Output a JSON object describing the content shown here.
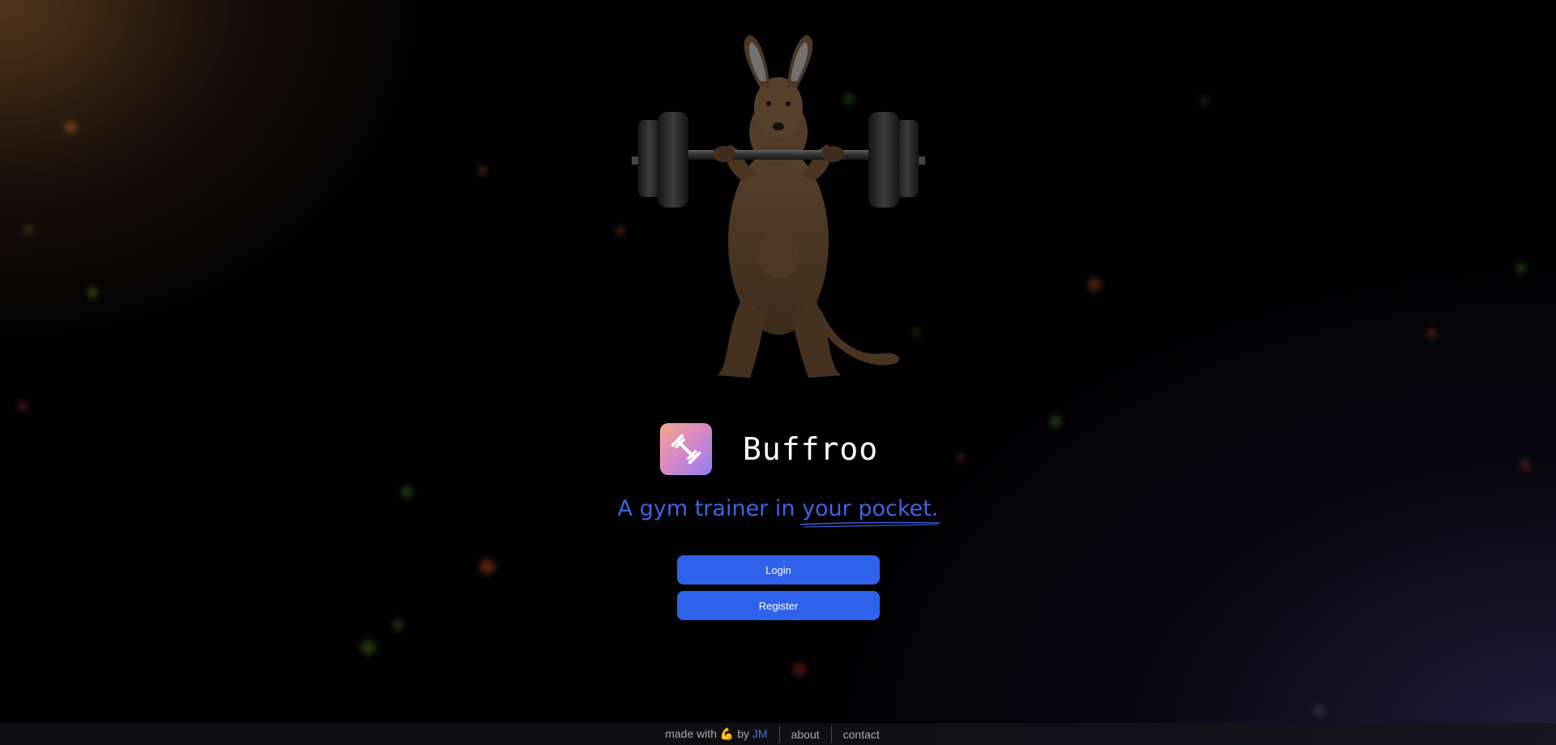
{
  "brand": {
    "name": "Buffroo",
    "icon": "dumbbell-icon"
  },
  "tagline": {
    "prefix": "A gym trainer in ",
    "highlight": "your pocket."
  },
  "actions": {
    "login_label": "Login",
    "register_label": "Register"
  },
  "footer": {
    "made_with": "made with",
    "emoji": "💪",
    "by": "by",
    "author": "JM",
    "about_label": "about",
    "contact_label": "contact"
  },
  "colors": {
    "accent": "#2f62ea",
    "tagline": "#3f63e0",
    "author_link": "#3f7be5"
  }
}
